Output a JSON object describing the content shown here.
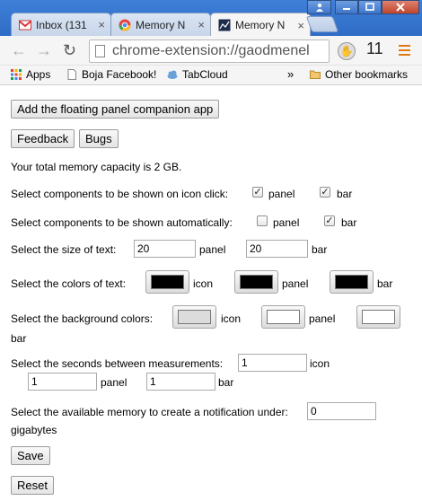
{
  "browser": {
    "tabs": [
      {
        "title": "Inbox (131",
        "favicon": "gmail-icon"
      },
      {
        "title": "Memory N",
        "favicon": "chrome-icon"
      },
      {
        "title": "Memory N",
        "favicon": "memory-extension-icon"
      }
    ],
    "tab_close": "×",
    "address": "chrome-extension://gaodmenel",
    "extension_badge": "11",
    "bookmarks": [
      {
        "label": "Apps",
        "icon": "apps-grid-icon"
      },
      {
        "label": "Boja Facebook!",
        "icon": "page-icon"
      },
      {
        "label": "TabCloud",
        "icon": "tabcloud-icon"
      }
    ],
    "overflow": "»",
    "other_bookmarks": "Other bookmarks"
  },
  "options": {
    "companion_button": "Add the floating panel companion app",
    "feedback_button": "Feedback",
    "bugs_button": "Bugs",
    "capacity_text": "Your total memory capacity is 2 GB.",
    "icon_click": {
      "label": "Select components to be shown on icon click:",
      "panel_label": "panel",
      "panel_checked": true,
      "bar_label": "bar",
      "bar_checked": true
    },
    "auto": {
      "label": "Select components to be shown automatically:",
      "panel_label": "panel",
      "panel_checked": false,
      "bar_label": "bar",
      "bar_checked": true
    },
    "text_size": {
      "label": "Select the size of text:",
      "panel_value": "20",
      "panel_label": "panel",
      "bar_value": "20",
      "bar_label": "bar"
    },
    "text_colors": {
      "label": "Select the colors of text:",
      "icon_color": "#000000",
      "icon_label": "icon",
      "panel_color": "#000000",
      "panel_label": "panel",
      "bar_color": "#000000",
      "bar_label": "bar"
    },
    "bg_colors": {
      "label": "Select the background colors:",
      "icon_color": "#dcdcdc",
      "icon_label": "icon",
      "panel_color": "#ffffff",
      "panel_label": "panel",
      "bar_color": "#ffffff",
      "bar_label": "bar"
    },
    "seconds": {
      "label": "Select the seconds between measurements:",
      "icon_value": "1",
      "icon_label": "icon",
      "panel_value": "1",
      "panel_label": "panel",
      "bar_value": "1",
      "bar_label": "bar"
    },
    "notify": {
      "label": "Select the available memory to create a notification under:",
      "value": "0",
      "unit": "gigabytes"
    },
    "save_button": "Save",
    "reset_button": "Reset"
  }
}
